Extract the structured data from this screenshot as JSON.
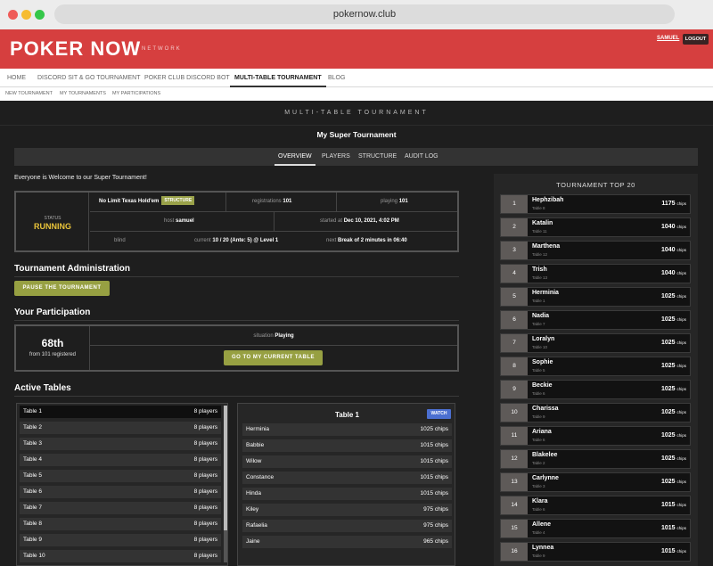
{
  "browser": {
    "url": "pokernow.club"
  },
  "site": {
    "logo": "POKER NOW",
    "network": "NETWORK",
    "user": "SAMUEL",
    "logout": "LOGOUT"
  },
  "nav": [
    "HOME",
    "DISCORD SIT & GO TOURNAMENT",
    "POKER CLUB DISCORD BOT",
    "MULTI-TABLE TOURNAMENT",
    "BLOG"
  ],
  "subnav": [
    "NEW TOURNAMENT",
    "MY TOURNAMENTS",
    "MY PARTICIPATIONS"
  ],
  "page": {
    "band": "MULTI-TABLE TOURNAMENT",
    "title": "My Super Tournament",
    "tabs": [
      "OVERVIEW",
      "PLAYERS",
      "STRUCTURE",
      "AUDIT LOG"
    ],
    "welcome": "Everyone is Welcome to our Super Tournament!"
  },
  "status": {
    "label": "STATUS",
    "value": "RUNNING",
    "game": "No Limit Texas Hold'em",
    "structure_btn": "STRUCTURE",
    "registrations_label": "registrations",
    "registrations": "101",
    "playing_label": "playing",
    "playing": "101",
    "host_label": "host",
    "host": "samuel",
    "started_label": "started at",
    "started": "Dec 10, 2021, 4:02 PM",
    "blind_label": "blind",
    "current_label": "current",
    "current": "10 / 20 (Ante: 5) @ Level 1",
    "next_label": "next",
    "next": "Break of 2 minutes in 06:40"
  },
  "admin": {
    "title": "Tournament Administration",
    "pause_btn": "PAUSE THE TOURNAMENT"
  },
  "participation": {
    "title": "Your Participation",
    "rank": "68th",
    "rank_sub": "from 101 registered",
    "situation_label": "situation",
    "situation": "Playing",
    "goto_btn": "GO TO MY CURRENT TABLE"
  },
  "active_tables": {
    "title": "Active Tables",
    "tables": [
      {
        "name": "Table 1",
        "players": "8 players"
      },
      {
        "name": "Table 2",
        "players": "8 players"
      },
      {
        "name": "Table 3",
        "players": "8 players"
      },
      {
        "name": "Table 4",
        "players": "8 players"
      },
      {
        "name": "Table 5",
        "players": "8 players"
      },
      {
        "name": "Table 6",
        "players": "8 players"
      },
      {
        "name": "Table 7",
        "players": "8 players"
      },
      {
        "name": "Table 8",
        "players": "8 players"
      },
      {
        "name": "Table 9",
        "players": "8 players"
      },
      {
        "name": "Table 10",
        "players": "8 players"
      }
    ],
    "detail": {
      "title": "Table 1",
      "watch": "WATCH",
      "players": [
        {
          "name": "Herminia",
          "chips": "1025 chips"
        },
        {
          "name": "Babbie",
          "chips": "1015 chips"
        },
        {
          "name": "Wilow",
          "chips": "1015 chips"
        },
        {
          "name": "Constance",
          "chips": "1015 chips"
        },
        {
          "name": "Hinda",
          "chips": "1015 chips"
        },
        {
          "name": "Kiley",
          "chips": "975 chips"
        },
        {
          "name": "Rafaelia",
          "chips": "975 chips"
        },
        {
          "name": "Jaine",
          "chips": "965 chips"
        }
      ]
    }
  },
  "top20": {
    "title": "TOURNAMENT TOP 20",
    "chips_unit": "chips",
    "entries": [
      {
        "rank": "1",
        "name": "Hephzibah",
        "table": "Table 8",
        "chips": "1175"
      },
      {
        "rank": "2",
        "name": "Katalin",
        "table": "Table 11",
        "chips": "1040"
      },
      {
        "rank": "3",
        "name": "Marthena",
        "table": "Table 12",
        "chips": "1040"
      },
      {
        "rank": "4",
        "name": "Trish",
        "table": "Table 13",
        "chips": "1040"
      },
      {
        "rank": "5",
        "name": "Herminia",
        "table": "Table 1",
        "chips": "1025"
      },
      {
        "rank": "6",
        "name": "Nadia",
        "table": "Table 7",
        "chips": "1025"
      },
      {
        "rank": "7",
        "name": "Loralyn",
        "table": "Table 10",
        "chips": "1025"
      },
      {
        "rank": "8",
        "name": "Sophie",
        "table": "Table 5",
        "chips": "1025"
      },
      {
        "rank": "9",
        "name": "Beckie",
        "table": "Table 6",
        "chips": "1025"
      },
      {
        "rank": "10",
        "name": "Charissa",
        "table": "Table 9",
        "chips": "1025"
      },
      {
        "rank": "11",
        "name": "Ariana",
        "table": "Table 6",
        "chips": "1025"
      },
      {
        "rank": "12",
        "name": "Blakelee",
        "table": "Table 2",
        "chips": "1025"
      },
      {
        "rank": "13",
        "name": "Carlynne",
        "table": "Table 3",
        "chips": "1025"
      },
      {
        "rank": "14",
        "name": "Klara",
        "table": "Table 6",
        "chips": "1015"
      },
      {
        "rank": "15",
        "name": "Allene",
        "table": "Table 4",
        "chips": "1015"
      },
      {
        "rank": "16",
        "name": "Lynnea",
        "table": "Table 9",
        "chips": "1015"
      }
    ]
  }
}
